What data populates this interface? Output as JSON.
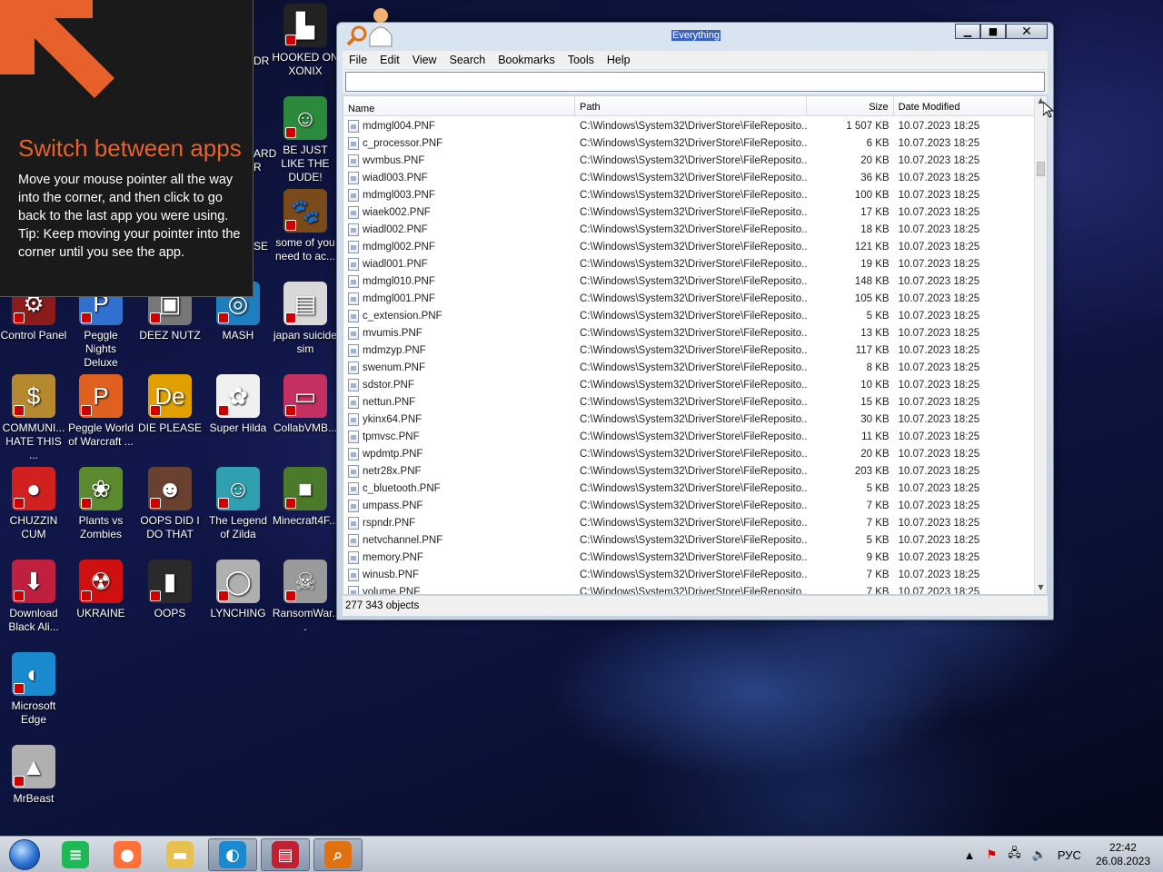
{
  "tip": {
    "title": "Switch between apps",
    "body": "Move your mouse pointer all the way into the corner, and then click to go back to the last app you were using.",
    "tip_line": "Tip: Keep moving your pointer into the corner until you see the app."
  },
  "desktop": {
    "partial_labels": [
      "DR",
      "ARD R",
      "SE"
    ],
    "icons": [
      {
        "label": "HOOKED ON XONIX",
        "icon": "maze-icon",
        "color": "#222222"
      },
      {
        "label": "BE JUST LIKE THE DUDE!",
        "icon": "elf-icon",
        "color": "#2c8a3c"
      },
      {
        "label": "some of you need to ac...",
        "icon": "beaver-icon",
        "color": "#7a4a1a"
      },
      {
        "label": "Control Panel",
        "icon": "control-panel-icon",
        "color": "#8a1c1c"
      },
      {
        "label": "Peggle Nights Deluxe",
        "icon": "peggle-icon",
        "color": "#3070d0"
      },
      {
        "label": "DEEZ NUTZ",
        "icon": "shortcut-icon",
        "color": "#777777"
      },
      {
        "label": "MASH",
        "icon": "mash-icon",
        "color": "#1d7fc0"
      },
      {
        "label": "japan suicide sim",
        "icon": "game-icon",
        "color": "#d9d9d9"
      },
      {
        "label": "COMMUNI... HATE THIS ...",
        "icon": "money-bag-icon",
        "color": "#b58a2f"
      },
      {
        "label": "Peggle World of Warcraft ...",
        "icon": "peggle-icon",
        "color": "#e06020"
      },
      {
        "label": "DIE PLEASE",
        "icon": "de-logo-icon",
        "color": "#e0a000"
      },
      {
        "label": "Super Hilda",
        "icon": "hilda-icon",
        "color": "#f0f0f0"
      },
      {
        "label": "CollabVMB...",
        "icon": "monitor-icon",
        "color": "#c43060"
      },
      {
        "label": "CHUZZIN CUM",
        "icon": "chuzzle-icon",
        "color": "#d02020"
      },
      {
        "label": "Plants vs Zombies",
        "icon": "flower-icon",
        "color": "#5c8a30"
      },
      {
        "label": "OOPS DID I DO THAT",
        "icon": "portrait-icon",
        "color": "#6a4030"
      },
      {
        "label": "The Legend of Zilda",
        "icon": "zilda-icon",
        "color": "#30a0b0"
      },
      {
        "label": "Minecraft4F...",
        "icon": "minecraft-icon",
        "color": "#4a7a2a"
      },
      {
        "label": "Download Black Ali...",
        "icon": "download-icon",
        "color": "#c02040"
      },
      {
        "label": "UKRAINE",
        "icon": "radiation-icon",
        "color": "#d01010"
      },
      {
        "label": "OOPS",
        "icon": "book-icon",
        "color": "#2a2a2a"
      },
      {
        "label": "LYNCHING",
        "icon": "ring-icon",
        "color": "#b0b0b0"
      },
      {
        "label": "RansomWar...",
        "icon": "skull-icon",
        "color": "#9a9a9a"
      },
      {
        "label": "Microsoft Edge",
        "icon": "edge-icon",
        "color": "#1a8ad0"
      },
      {
        "label": "MrBeast",
        "icon": "mrbeast-icon",
        "color": "#b0b0b0"
      }
    ]
  },
  "window": {
    "title": "Everything",
    "menu": [
      "File",
      "Edit",
      "View",
      "Search",
      "Bookmarks",
      "Tools",
      "Help"
    ],
    "search_value": "",
    "columns": [
      "Name",
      "Path",
      "Size",
      "Date Modified"
    ],
    "rows": [
      {
        "name": "mdmgl004.PNF",
        "path": "C:\\Windows\\System32\\DriverStore\\FileReposito...",
        "size": "1 507 KB",
        "date": "10.07.2023 18:25"
      },
      {
        "name": "c_processor.PNF",
        "path": "C:\\Windows\\System32\\DriverStore\\FileReposito...",
        "size": "6 KB",
        "date": "10.07.2023 18:25"
      },
      {
        "name": "wvmbus.PNF",
        "path": "C:\\Windows\\System32\\DriverStore\\FileReposito...",
        "size": "20 KB",
        "date": "10.07.2023 18:25"
      },
      {
        "name": "wiadl003.PNF",
        "path": "C:\\Windows\\System32\\DriverStore\\FileReposito...",
        "size": "36 KB",
        "date": "10.07.2023 18:25"
      },
      {
        "name": "mdmgl003.PNF",
        "path": "C:\\Windows\\System32\\DriverStore\\FileReposito...",
        "size": "100 KB",
        "date": "10.07.2023 18:25"
      },
      {
        "name": "wiaek002.PNF",
        "path": "C:\\Windows\\System32\\DriverStore\\FileReposito...",
        "size": "17 KB",
        "date": "10.07.2023 18:25"
      },
      {
        "name": "wiadl002.PNF",
        "path": "C:\\Windows\\System32\\DriverStore\\FileReposito...",
        "size": "18 KB",
        "date": "10.07.2023 18:25"
      },
      {
        "name": "mdmgl002.PNF",
        "path": "C:\\Windows\\System32\\DriverStore\\FileReposito...",
        "size": "121 KB",
        "date": "10.07.2023 18:25"
      },
      {
        "name": "wiadl001.PNF",
        "path": "C:\\Windows\\System32\\DriverStore\\FileReposito...",
        "size": "19 KB",
        "date": "10.07.2023 18:25"
      },
      {
        "name": "mdmgl010.PNF",
        "path": "C:\\Windows\\System32\\DriverStore\\FileReposito...",
        "size": "148 KB",
        "date": "10.07.2023 18:25"
      },
      {
        "name": "mdmgl001.PNF",
        "path": "C:\\Windows\\System32\\DriverStore\\FileReposito...",
        "size": "105 KB",
        "date": "10.07.2023 18:25"
      },
      {
        "name": "c_extension.PNF",
        "path": "C:\\Windows\\System32\\DriverStore\\FileReposito...",
        "size": "5 KB",
        "date": "10.07.2023 18:25"
      },
      {
        "name": "mvumis.PNF",
        "path": "C:\\Windows\\System32\\DriverStore\\FileReposito...",
        "size": "13 KB",
        "date": "10.07.2023 18:25"
      },
      {
        "name": "mdmzyp.PNF",
        "path": "C:\\Windows\\System32\\DriverStore\\FileReposito...",
        "size": "117 KB",
        "date": "10.07.2023 18:25"
      },
      {
        "name": "swenum.PNF",
        "path": "C:\\Windows\\System32\\DriverStore\\FileReposito...",
        "size": "8 KB",
        "date": "10.07.2023 18:25"
      },
      {
        "name": "sdstor.PNF",
        "path": "C:\\Windows\\System32\\DriverStore\\FileReposito...",
        "size": "10 KB",
        "date": "10.07.2023 18:25"
      },
      {
        "name": "nettun.PNF",
        "path": "C:\\Windows\\System32\\DriverStore\\FileReposito...",
        "size": "15 KB",
        "date": "10.07.2023 18:25"
      },
      {
        "name": "ykinx64.PNF",
        "path": "C:\\Windows\\System32\\DriverStore\\FileReposito...",
        "size": "30 KB",
        "date": "10.07.2023 18:25"
      },
      {
        "name": "tpmvsc.PNF",
        "path": "C:\\Windows\\System32\\DriverStore\\FileReposito...",
        "size": "11 KB",
        "date": "10.07.2023 18:25"
      },
      {
        "name": "wpdmtp.PNF",
        "path": "C:\\Windows\\System32\\DriverStore\\FileReposito...",
        "size": "20 KB",
        "date": "10.07.2023 18:25"
      },
      {
        "name": "netr28x.PNF",
        "path": "C:\\Windows\\System32\\DriverStore\\FileReposito...",
        "size": "203 KB",
        "date": "10.07.2023 18:25"
      },
      {
        "name": "c_bluetooth.PNF",
        "path": "C:\\Windows\\System32\\DriverStore\\FileReposito...",
        "size": "5 KB",
        "date": "10.07.2023 18:25"
      },
      {
        "name": "umpass.PNF",
        "path": "C:\\Windows\\System32\\DriverStore\\FileReposito...",
        "size": "7 KB",
        "date": "10.07.2023 18:25"
      },
      {
        "name": "rspndr.PNF",
        "path": "C:\\Windows\\System32\\DriverStore\\FileReposito...",
        "size": "7 KB",
        "date": "10.07.2023 18:25"
      },
      {
        "name": "netvchannel.PNF",
        "path": "C:\\Windows\\System32\\DriverStore\\FileReposito...",
        "size": "5 KB",
        "date": "10.07.2023 18:25"
      },
      {
        "name": "memory.PNF",
        "path": "C:\\Windows\\System32\\DriverStore\\FileReposito...",
        "size": "9 KB",
        "date": "10.07.2023 18:25"
      },
      {
        "name": "winusb.PNF",
        "path": "C:\\Windows\\System32\\DriverStore\\FileReposito...",
        "size": "7 KB",
        "date": "10.07.2023 18:25"
      },
      {
        "name": "volume.PNF",
        "path": "C:\\Windows\\System32\\DriverStore\\FileReposito...",
        "size": "7 KB",
        "date": "10.07.2023 18:25"
      }
    ],
    "status": "277 343 objects"
  },
  "taskbar": {
    "apps": [
      {
        "name": "start-orb",
        "icon": "windows-orb-icon",
        "color": "#2a6fd0"
      },
      {
        "name": "spotify",
        "icon": "spotify-icon",
        "color": "#1db954"
      },
      {
        "name": "firefox",
        "icon": "firefox-icon",
        "color": "#ff7139"
      },
      {
        "name": "file-explorer",
        "icon": "folder-icon",
        "color": "#e8c050"
      },
      {
        "name": "edge",
        "icon": "edge-icon",
        "color": "#1a8ad0"
      },
      {
        "name": "news",
        "icon": "news-icon",
        "color": "#c02030"
      },
      {
        "name": "everything",
        "icon": "magnifier-icon",
        "color": "#e07010"
      }
    ],
    "tray": {
      "language": "РУС",
      "time": "22:42",
      "date": "26.08.2023"
    }
  }
}
